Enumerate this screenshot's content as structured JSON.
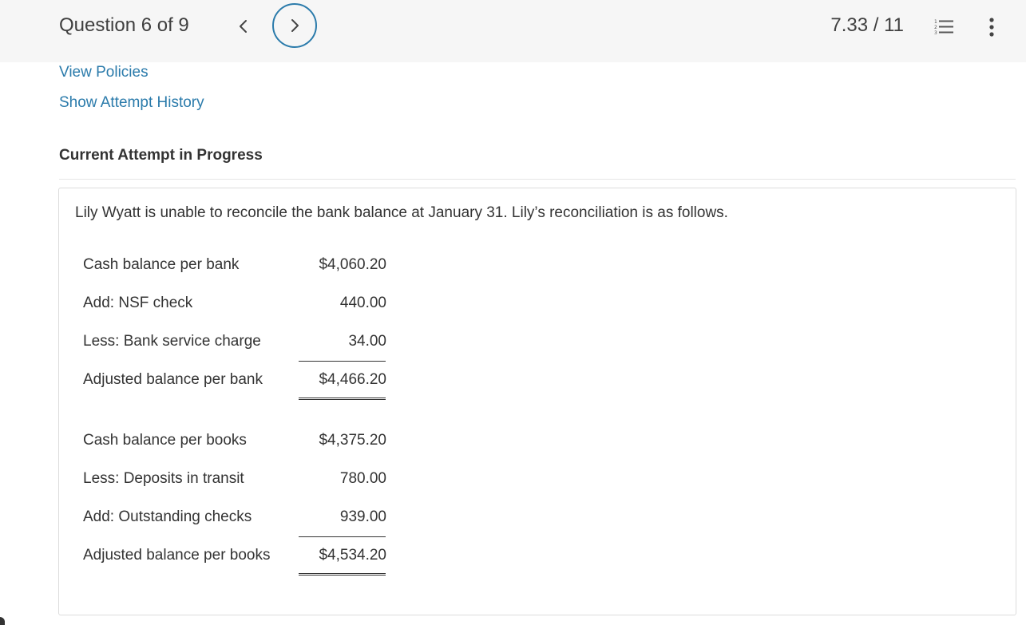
{
  "header": {
    "question_label": "Question 6 of 9",
    "score": "7.33 / 11",
    "accent_color": "#2b7bab",
    "prev_icon": "chevron-left-icon",
    "next_icon": "chevron-right-icon",
    "list_icon": "numbered-list-icon",
    "more_icon": "vertical-ellipsis-icon"
  },
  "links": {
    "view_policies": "View Policies",
    "show_attempt_history": "Show Attempt History"
  },
  "attempt_status": "Current Attempt in Progress",
  "question": {
    "prompt": "Lily Wyatt is unable to reconcile the bank balance at January 31. Lily’s reconciliation is as follows.",
    "bank_section": [
      {
        "label": "Cash balance per bank",
        "amount": "$4,060.20"
      },
      {
        "label": "Add: NSF check",
        "amount": "440.00"
      },
      {
        "label": "Less: Bank service charge",
        "amount": "34.00"
      },
      {
        "label": "Adjusted balance per bank",
        "amount": "$4,466.20"
      }
    ],
    "books_section": [
      {
        "label": "Cash balance per books",
        "amount": "$4,375.20"
      },
      {
        "label": "Less: Deposits in transit",
        "amount": "780.00"
      },
      {
        "label": "Add: Outstanding checks",
        "amount": "939.00"
      },
      {
        "label": "Adjusted balance per books",
        "amount": "$4,534.20"
      }
    ]
  }
}
